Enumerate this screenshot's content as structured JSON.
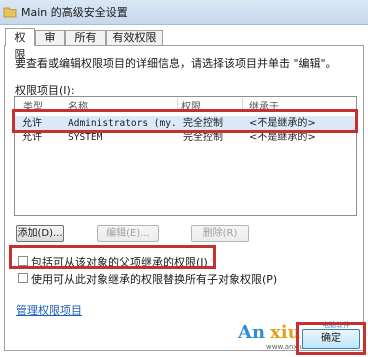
{
  "window": {
    "title": "Main 的高级安全设置"
  },
  "tabs": [
    "权限",
    "审核",
    "所有者",
    "有效权限"
  ],
  "permissions": {
    "description": "要查看或编辑权限项目的详细信息，请选择该项目并单击 \"编辑\"。",
    "list_label": "权限项目(I):",
    "columns": [
      "类型",
      "名称",
      "权限",
      "继承于"
    ],
    "rows": [
      {
        "type": "允许",
        "name": "Administrators (my...",
        "permission": "完全控制",
        "inherited": "<不是继承的>"
      },
      {
        "type": "允许",
        "name": "SYSTEM",
        "permission": "完全控制",
        "inherited": "<不是继承的>"
      }
    ]
  },
  "buttons": {
    "add": "添加(D)...",
    "edit": "编辑(E)...",
    "remove": "删除(R)"
  },
  "checkboxes": {
    "include_inheritable": "包括可从该对象的父项继承的权限(I)",
    "replace_child": "使用可从此对象继承的权限替换所有子对象权限(P)"
  },
  "link": {
    "manage": "管理权限项目"
  },
  "ok_button": "确定",
  "watermark": {
    "an": "An",
    "xiu": "xiu",
    "url": "www.anxiu.com",
    "caption": "电脑软件"
  },
  "colors": {
    "annotation_red": "#c8302f",
    "selection": "#dbe9f8",
    "link": "#1a5fb4"
  }
}
